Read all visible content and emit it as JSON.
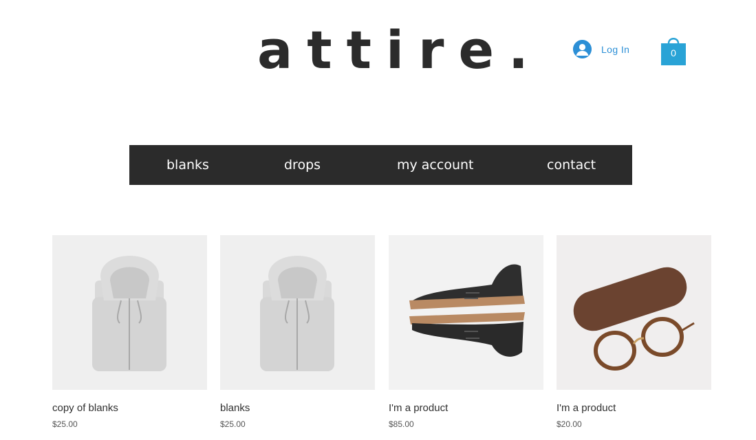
{
  "header": {
    "logo": "attire.",
    "login_label": "Log In",
    "cart_count": "0",
    "accent_color": "#2c8fd6",
    "cart_color": "#29a3d6"
  },
  "nav": {
    "items": [
      {
        "label": "blanks"
      },
      {
        "label": "drops"
      },
      {
        "label": "my account"
      },
      {
        "label": "contact"
      }
    ],
    "background": "#2b2b2b"
  },
  "products": [
    {
      "name": "copy of blanks",
      "price": "$25.00",
      "image": "folded-hoodie-image"
    },
    {
      "name": "blanks",
      "price": "$25.00",
      "image": "folded-hoodie-image"
    },
    {
      "name": "I'm a product",
      "price": "$85.00",
      "image": "leather-shoes-image"
    },
    {
      "name": "I'm a product",
      "price": "$20.00",
      "image": "glasses-and-case-image"
    }
  ]
}
